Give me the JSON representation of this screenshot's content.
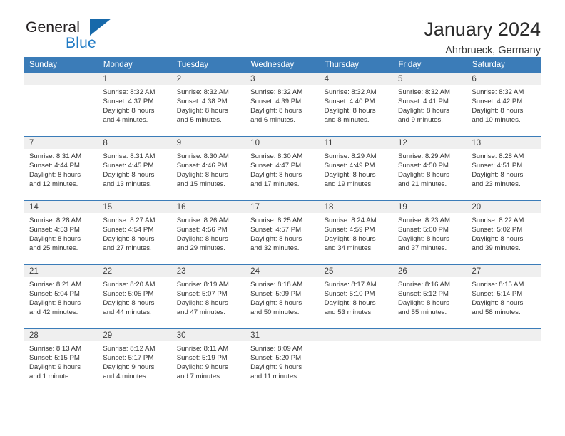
{
  "brand": {
    "word_one": "General",
    "word_two": "Blue",
    "triangle_icon": "triangle-logo-icon",
    "accent_color": "#1f7ac4"
  },
  "header": {
    "title": "January 2024",
    "subtitle": "Ahrbrueck, Germany"
  },
  "theme": {
    "header_blue": "#3b7cb8",
    "daynum_band": "#efefef",
    "text": "#333333"
  },
  "weekday_headers": [
    "Sunday",
    "Monday",
    "Tuesday",
    "Wednesday",
    "Thursday",
    "Friday",
    "Saturday"
  ],
  "labels": {
    "sunrise": "Sunrise:",
    "sunset": "Sunset:",
    "daylight": "Daylight:"
  },
  "weeks": [
    [
      {
        "day": "",
        "lines": []
      },
      {
        "day": "1",
        "lines": [
          "Sunrise: 8:32 AM",
          "Sunset: 4:37 PM",
          "Daylight: 8 hours",
          "and 4 minutes."
        ]
      },
      {
        "day": "2",
        "lines": [
          "Sunrise: 8:32 AM",
          "Sunset: 4:38 PM",
          "Daylight: 8 hours",
          "and 5 minutes."
        ]
      },
      {
        "day": "3",
        "lines": [
          "Sunrise: 8:32 AM",
          "Sunset: 4:39 PM",
          "Daylight: 8 hours",
          "and 6 minutes."
        ]
      },
      {
        "day": "4",
        "lines": [
          "Sunrise: 8:32 AM",
          "Sunset: 4:40 PM",
          "Daylight: 8 hours",
          "and 8 minutes."
        ]
      },
      {
        "day": "5",
        "lines": [
          "Sunrise: 8:32 AM",
          "Sunset: 4:41 PM",
          "Daylight: 8 hours",
          "and 9 minutes."
        ]
      },
      {
        "day": "6",
        "lines": [
          "Sunrise: 8:32 AM",
          "Sunset: 4:42 PM",
          "Daylight: 8 hours",
          "and 10 minutes."
        ]
      }
    ],
    [
      {
        "day": "7",
        "lines": [
          "Sunrise: 8:31 AM",
          "Sunset: 4:44 PM",
          "Daylight: 8 hours",
          "and 12 minutes."
        ]
      },
      {
        "day": "8",
        "lines": [
          "Sunrise: 8:31 AM",
          "Sunset: 4:45 PM",
          "Daylight: 8 hours",
          "and 13 minutes."
        ]
      },
      {
        "day": "9",
        "lines": [
          "Sunrise: 8:30 AM",
          "Sunset: 4:46 PM",
          "Daylight: 8 hours",
          "and 15 minutes."
        ]
      },
      {
        "day": "10",
        "lines": [
          "Sunrise: 8:30 AM",
          "Sunset: 4:47 PM",
          "Daylight: 8 hours",
          "and 17 minutes."
        ]
      },
      {
        "day": "11",
        "lines": [
          "Sunrise: 8:29 AM",
          "Sunset: 4:49 PM",
          "Daylight: 8 hours",
          "and 19 minutes."
        ]
      },
      {
        "day": "12",
        "lines": [
          "Sunrise: 8:29 AM",
          "Sunset: 4:50 PM",
          "Daylight: 8 hours",
          "and 21 minutes."
        ]
      },
      {
        "day": "13",
        "lines": [
          "Sunrise: 8:28 AM",
          "Sunset: 4:51 PM",
          "Daylight: 8 hours",
          "and 23 minutes."
        ]
      }
    ],
    [
      {
        "day": "14",
        "lines": [
          "Sunrise: 8:28 AM",
          "Sunset: 4:53 PM",
          "Daylight: 8 hours",
          "and 25 minutes."
        ]
      },
      {
        "day": "15",
        "lines": [
          "Sunrise: 8:27 AM",
          "Sunset: 4:54 PM",
          "Daylight: 8 hours",
          "and 27 minutes."
        ]
      },
      {
        "day": "16",
        "lines": [
          "Sunrise: 8:26 AM",
          "Sunset: 4:56 PM",
          "Daylight: 8 hours",
          "and 29 minutes."
        ]
      },
      {
        "day": "17",
        "lines": [
          "Sunrise: 8:25 AM",
          "Sunset: 4:57 PM",
          "Daylight: 8 hours",
          "and 32 minutes."
        ]
      },
      {
        "day": "18",
        "lines": [
          "Sunrise: 8:24 AM",
          "Sunset: 4:59 PM",
          "Daylight: 8 hours",
          "and 34 minutes."
        ]
      },
      {
        "day": "19",
        "lines": [
          "Sunrise: 8:23 AM",
          "Sunset: 5:00 PM",
          "Daylight: 8 hours",
          "and 37 minutes."
        ]
      },
      {
        "day": "20",
        "lines": [
          "Sunrise: 8:22 AM",
          "Sunset: 5:02 PM",
          "Daylight: 8 hours",
          "and 39 minutes."
        ]
      }
    ],
    [
      {
        "day": "21",
        "lines": [
          "Sunrise: 8:21 AM",
          "Sunset: 5:04 PM",
          "Daylight: 8 hours",
          "and 42 minutes."
        ]
      },
      {
        "day": "22",
        "lines": [
          "Sunrise: 8:20 AM",
          "Sunset: 5:05 PM",
          "Daylight: 8 hours",
          "and 44 minutes."
        ]
      },
      {
        "day": "23",
        "lines": [
          "Sunrise: 8:19 AM",
          "Sunset: 5:07 PM",
          "Daylight: 8 hours",
          "and 47 minutes."
        ]
      },
      {
        "day": "24",
        "lines": [
          "Sunrise: 8:18 AM",
          "Sunset: 5:09 PM",
          "Daylight: 8 hours",
          "and 50 minutes."
        ]
      },
      {
        "day": "25",
        "lines": [
          "Sunrise: 8:17 AM",
          "Sunset: 5:10 PM",
          "Daylight: 8 hours",
          "and 53 minutes."
        ]
      },
      {
        "day": "26",
        "lines": [
          "Sunrise: 8:16 AM",
          "Sunset: 5:12 PM",
          "Daylight: 8 hours",
          "and 55 minutes."
        ]
      },
      {
        "day": "27",
        "lines": [
          "Sunrise: 8:15 AM",
          "Sunset: 5:14 PM",
          "Daylight: 8 hours",
          "and 58 minutes."
        ]
      }
    ],
    [
      {
        "day": "28",
        "lines": [
          "Sunrise: 8:13 AM",
          "Sunset: 5:15 PM",
          "Daylight: 9 hours",
          "and 1 minute."
        ]
      },
      {
        "day": "29",
        "lines": [
          "Sunrise: 8:12 AM",
          "Sunset: 5:17 PM",
          "Daylight: 9 hours",
          "and 4 minutes."
        ]
      },
      {
        "day": "30",
        "lines": [
          "Sunrise: 8:11 AM",
          "Sunset: 5:19 PM",
          "Daylight: 9 hours",
          "and 7 minutes."
        ]
      },
      {
        "day": "31",
        "lines": [
          "Sunrise: 8:09 AM",
          "Sunset: 5:20 PM",
          "Daylight: 9 hours",
          "and 11 minutes."
        ]
      },
      {
        "day": "",
        "lines": []
      },
      {
        "day": "",
        "lines": []
      },
      {
        "day": "",
        "lines": []
      }
    ]
  ]
}
